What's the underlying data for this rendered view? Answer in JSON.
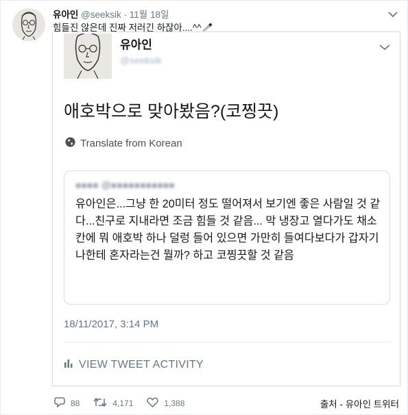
{
  "tweet": {
    "name": "유아인",
    "handle": "@seeksik",
    "separator": "·",
    "date": "11월 18일",
    "text": "힘들진 않은데 진짜 저러긴 하잖아....^^",
    "text_emoji": "knife"
  },
  "embedded": {
    "name": "유아인",
    "handle": "@seeksik",
    "main_text": "애호박으로 맞아봤음?(코찡끗)",
    "translate_label": "Translate from Korean",
    "quoted": {
      "header_blurred": "●●●● @●●●●●●●●●●●",
      "body": "유아인은...그냥 한 20미터 정도 떨어져서 보기엔 좋은 사람일 것 같다...친구로 지내라면 조금 힘들 것 같음... 막 냉장고 열다가도 채소칸에 뭐 애호박 하나 덜렁 들어 있으면 가만히 들여다보다가 갑자기 나한테 혼자라는건 뭘까? 하고 코찡끗할 것 같음"
    },
    "timestamp": "18/11/2017, 3:14 PM",
    "activity_label": "VIEW TWEET ACTIVITY"
  },
  "actions": {
    "replies": "88",
    "retweets": "4,171",
    "likes": "1,388"
  },
  "credit": "출처 - 유아인 트위터",
  "colors": {
    "text": "#14171a",
    "muted": "#657786",
    "border": "#e6ecf0"
  }
}
